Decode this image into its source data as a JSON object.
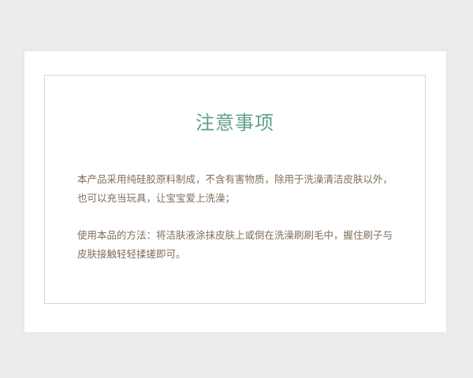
{
  "notice": {
    "title": "注意事项",
    "paragraphs": [
      "本产品采用纯硅胶原料制成，不含有害物质，除用于洗澡清洁皮肤以外，也可以充当玩具，让宝宝爱上洗澡；",
      "使用本品的方法：将洁肤液涂抹皮肤上或倒在洗澡刷刷毛中，握住刷子与皮肤接触轻轻揉搓即可。"
    ]
  }
}
